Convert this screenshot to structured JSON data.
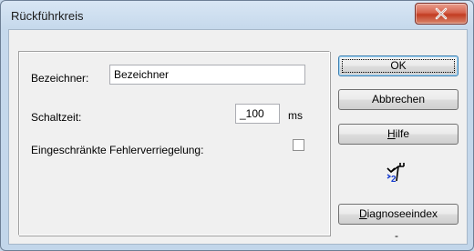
{
  "window": {
    "title": "Rückführkreis"
  },
  "form": {
    "bezeichner_label": "Bezeichner:",
    "bezeichner_value": "Bezeichner",
    "schaltzeit_label": "Schaltzeit:",
    "schaltzeit_value": "_100",
    "schaltzeit_unit": "ms",
    "fehler_label": "Eingeschränkte Fehlerverriegelung:",
    "fehler_checked": false
  },
  "buttons": {
    "ok": "OK",
    "abbrechen": "Abbrechen",
    "hilfe_accel": "H",
    "hilfe_rest": "ilfe",
    "diag_accel": "D",
    "diag_rest": "iagnoseeindex"
  },
  "diagnose": {
    "icon": "feedback-circuit-icon",
    "status": "-"
  },
  "colors": {
    "accent": "#3c7fb1",
    "icon_blue": "#1a3fd0"
  }
}
